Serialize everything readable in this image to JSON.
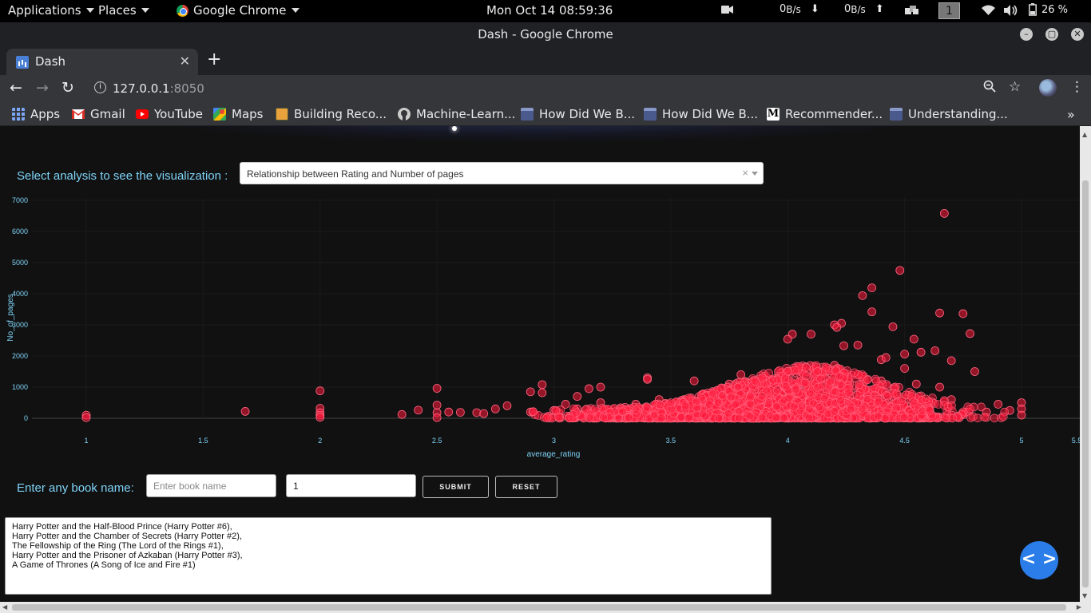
{
  "system_bar": {
    "applications": "Applications",
    "places": "Places",
    "app_name": "Google Chrome",
    "clock": "Mon Oct 14  08:59:36",
    "net_down_value": "0",
    "net_down_unit": "B/s",
    "net_up_value": "0",
    "net_up_unit": "B/s",
    "workspace": "1",
    "battery": "26 %"
  },
  "window": {
    "title": "Dash - Google Chrome"
  },
  "tab": {
    "title": "Dash"
  },
  "omnibox": {
    "host": "127.0.0.1",
    "port": ":8050"
  },
  "bookmarks": [
    {
      "label": "Apps",
      "icon": "apps-grid-icon",
      "color": "#4285f4"
    },
    {
      "label": "Gmail",
      "icon": "gmail-icon",
      "color": "#d93025"
    },
    {
      "label": "YouTube",
      "icon": "youtube-icon",
      "color": "#ff0000"
    },
    {
      "label": "Maps",
      "icon": "maps-icon",
      "color": "#34a853"
    },
    {
      "label": "Building Reco...",
      "icon": "site-icon",
      "color": "#e8a33c"
    },
    {
      "label": "Machine-Learn...",
      "icon": "github-icon",
      "color": "#cccccc"
    },
    {
      "label": "How Did We B...",
      "icon": "doc-icon",
      "color": "#4a5a8c"
    },
    {
      "label": "How Did We B...",
      "icon": "doc-icon",
      "color": "#4a5a8c"
    },
    {
      "label": "Recommender...",
      "icon": "medium-icon",
      "color": "#000000"
    },
    {
      "label": "Understanding...",
      "icon": "doc-icon",
      "color": "#4a5a8c"
    }
  ],
  "page": {
    "select_label": "Select analysis to see the visualization :",
    "dropdown_value": "Relationship between Rating and Number of pages",
    "dropdown_clear": "×",
    "enter_label": "Enter any book name:",
    "book_input_placeholder": "Enter book name",
    "count_input_value": "1",
    "submit_label": "SUBMIT",
    "reset_label": "RESET",
    "results": [
      "Harry Potter and the Half-Blood Prince (Harry Potter  #6),",
      "Harry Potter and the Chamber of Secrets (Harry Potter  #2),",
      "The Fellowship of the Ring (The Lord of the Rings  #1),",
      "Harry Potter and the Prisoner of Azkaban (Harry Potter  #3),",
      "A Game of Thrones (A Song of Ice and Fire  #1)"
    ],
    "fab_symbol": "< >"
  },
  "chart_data": {
    "type": "scatter",
    "xlabel": "average_rating",
    "ylabel": "No_of_pages",
    "xlim": [
      0.95,
      5.2
    ],
    "ylim": [
      0,
      7000
    ],
    "x_ticks": [
      1,
      1.5,
      2,
      2.5,
      3,
      3.5,
      4,
      4.5,
      5
    ],
    "x_tick_labels": [
      "1",
      "1.5",
      "2",
      "2.5",
      "3",
      "3.5",
      "4",
      "4.5",
      "5",
      "5.5"
    ],
    "y_ticks": [
      0,
      1000,
      2000,
      3000,
      4000,
      5000,
      6000,
      7000
    ],
    "y_tick_labels": [
      "0",
      "1000",
      "2000",
      "3000",
      "4000",
      "5000",
      "6000",
      "7000"
    ],
    "marker_color": "#ff1a3c",
    "points_x": [
      1,
      1,
      1.68,
      2,
      2,
      2,
      2,
      2,
      2.35,
      2.42,
      2.5,
      2.5,
      2.5,
      2.5,
      2.55,
      2.6,
      2.67,
      2.75,
      2.8,
      2.9,
      2.95,
      3.0,
      3.05,
      3.1,
      3.15,
      3.2,
      3.3,
      3.35,
      3.4,
      3.45,
      3.5,
      3.6,
      3.65,
      3.7,
      3.75,
      3.8,
      3.85,
      3.9,
      3.95,
      4.0,
      4.05,
      4.1,
      4.15,
      4.2,
      4.25,
      4.3,
      4.35,
      4.4,
      4.45,
      4.5,
      4.55,
      4.6,
      4.65,
      4.7,
      4.75,
      4.8,
      4.85,
      4.9,
      4.95,
      5,
      5,
      5,
      4.67,
      4.36,
      4.48,
      4.32,
      4.23,
      4.2,
      4.21,
      4.36,
      4.02,
      4.65,
      4.45,
      4.24,
      4.75,
      4.78,
      4.54,
      4.0,
      4.1,
      4.3,
      4.57,
      4.63,
      4.5,
      4.4,
      4.42,
      4.7,
      3.8,
      3.4,
      3.2,
      2.95,
      2.9,
      3.1,
      2.7
    ],
    "points_y": [
      100,
      20,
      220,
      880,
      320,
      180,
      100,
      30,
      120,
      260,
      960,
      420,
      180,
      20,
      200,
      190,
      180,
      300,
      400,
      200,
      1080,
      250,
      450,
      300,
      950,
      500,
      280,
      450,
      1300,
      600,
      320,
      1200,
      700,
      300,
      1100,
      900,
      500,
      1300,
      250,
      1500,
      1100,
      800,
      600,
      1700,
      400,
      1400,
      900,
      1200,
      700,
      1600,
      1100,
      300,
      1000,
      600,
      150,
      1500,
      200,
      450,
      250,
      500,
      300,
      100,
      6580,
      4190,
      4750,
      3940,
      3050,
      3000,
      2920,
      3420,
      2700,
      3380,
      2940,
      2330,
      3360,
      2720,
      2540,
      2540,
      2700,
      2350,
      2120,
      2170,
      2060,
      1880,
      1950,
      1850,
      1400,
      1250,
      1000,
      820,
      850,
      700,
      150
    ]
  }
}
